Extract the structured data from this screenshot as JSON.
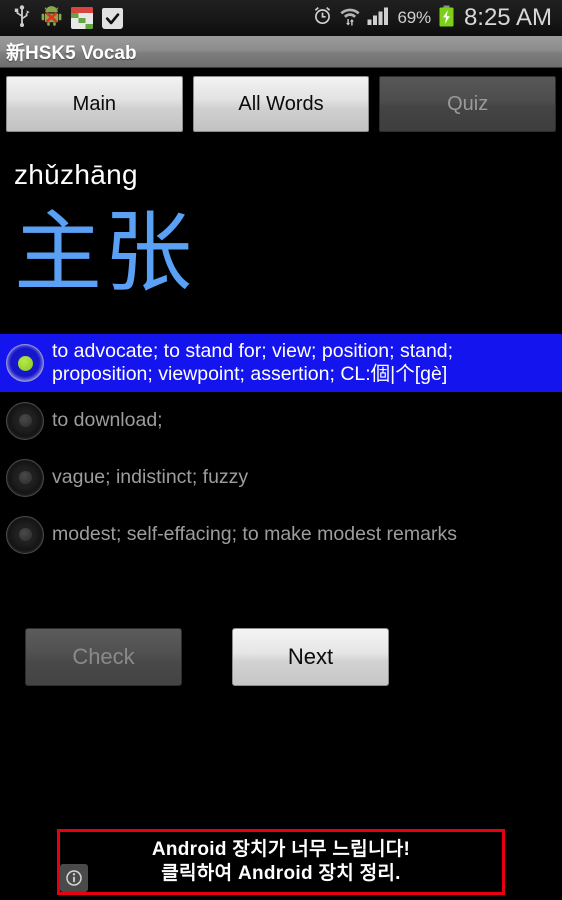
{
  "status_bar": {
    "left_icons": [
      {
        "name": "usb-icon",
        "label": "USB"
      },
      {
        "name": "android-debug-icon",
        "label": "Android"
      },
      {
        "name": "calendar-icon",
        "label": "Calendar"
      },
      {
        "name": "shopping-bag-check-icon",
        "label": "Store"
      }
    ],
    "right_icons": [
      {
        "name": "alarm-clock-icon",
        "label": "Alarm"
      },
      {
        "name": "wifi-icon",
        "label": "Wi-Fi"
      },
      {
        "name": "signal-bars-icon",
        "label": "Signal"
      }
    ],
    "battery_percent": "69%",
    "battery_icon": "battery-charging-icon",
    "clock": "8:25 AM"
  },
  "title_bar": {
    "title": "新HSK5 Vocab"
  },
  "tabs": [
    {
      "label": "Main",
      "name": "tab-main",
      "state": "inactive"
    },
    {
      "label": "All Words",
      "name": "tab-all-words",
      "state": "inactive"
    },
    {
      "label": "Quiz",
      "name": "tab-quiz",
      "state": "active"
    }
  ],
  "word": {
    "pinyin": "zhǔzhāng",
    "hanzi": "主张"
  },
  "quiz": {
    "options": [
      {
        "text": "to advocate; to stand for; view; position; stand; proposition; viewpoint; assertion; CL:個|个[gè]",
        "selected": true
      },
      {
        "text": "to download;",
        "selected": false
      },
      {
        "text": "vague; indistinct; fuzzy",
        "selected": false
      },
      {
        "text": "modest; self-effacing; to make modest remarks",
        "selected": false
      }
    ],
    "selected_highlight_color": "#1414ee",
    "selected_dot_color": "#95d12c"
  },
  "actions": {
    "check_label": "Check",
    "check_enabled": false,
    "next_label": "Next",
    "next_enabled": true
  },
  "ad": {
    "line1": "Android 장치가 너무 느립니다!",
    "line2": "클릭하여 Android 장치 정리.",
    "border_color": "#e60012",
    "info_icon": "ad-info-icon"
  }
}
